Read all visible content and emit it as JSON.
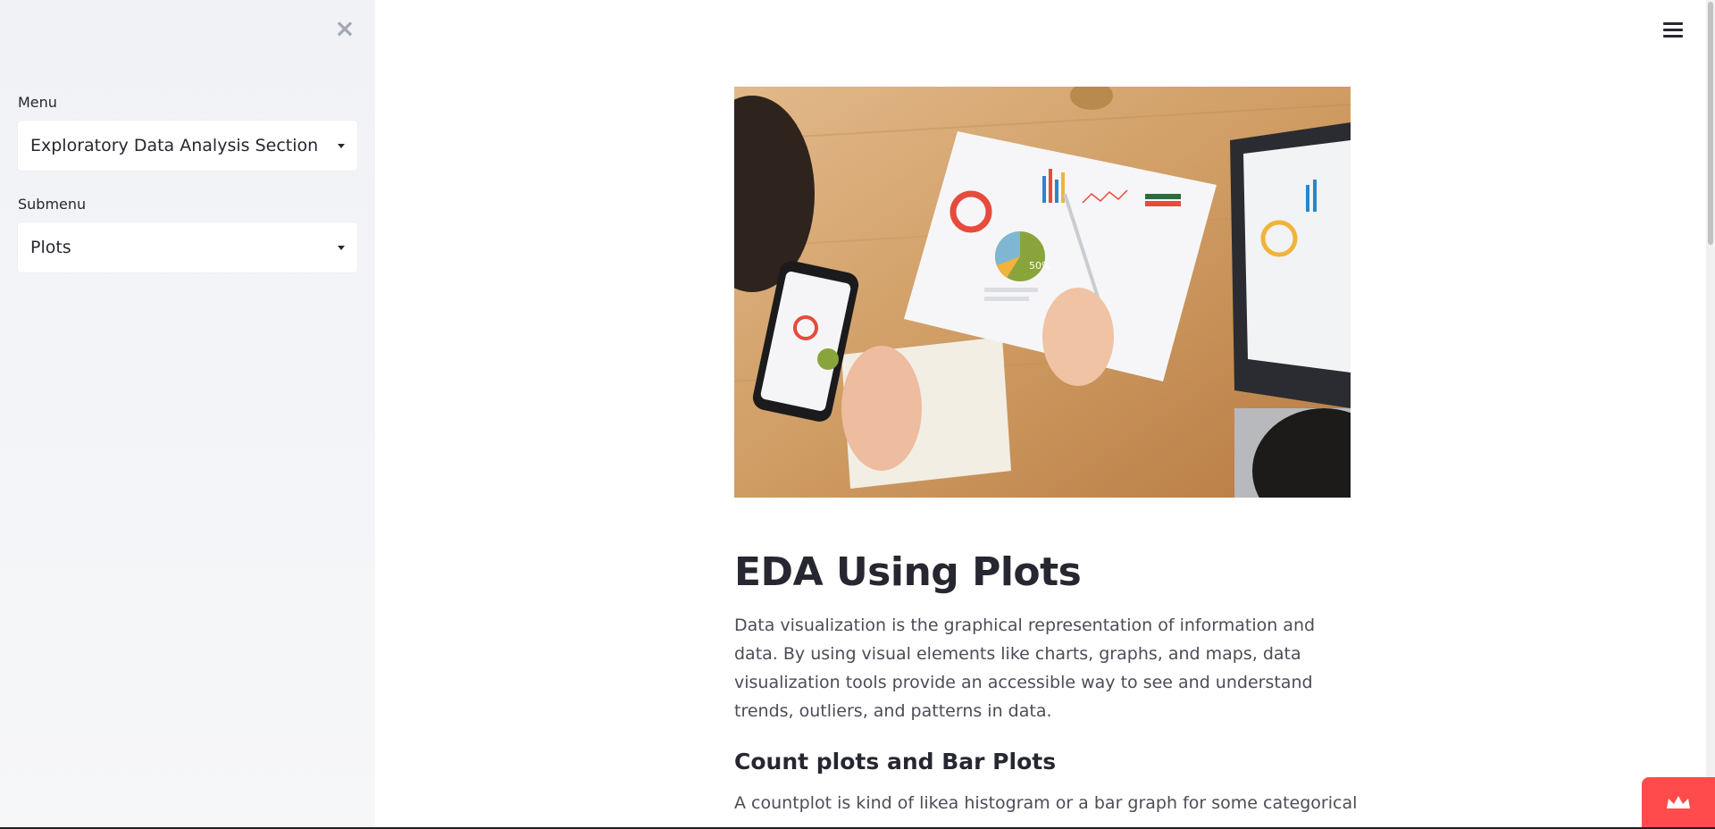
{
  "sidebar": {
    "menu_label": "Menu",
    "menu_selected": "Exploratory Data Analysis Section",
    "submenu_label": "Submenu",
    "submenu_selected": "Plots"
  },
  "main": {
    "title": "EDA Using Plots",
    "intro": "Data visualization is the graphical representation of information and data. By using visual elements like charts, graphs, and maps, data visualization tools provide an accessible way to see and understand trends, outliers, and patterns in data.",
    "section_heading": "Count plots and Bar Plots",
    "section_text": "A countplot is kind of likea histogram or a bar graph for some categorical",
    "hero_text": "50%"
  },
  "colors": {
    "accent": "#ff4b4b",
    "sidebar_bg": "#f0f2f6",
    "text": "#262730"
  },
  "icons": {
    "close": "close-icon",
    "menu": "hamburger-menu-icon",
    "badge": "crown-icon"
  }
}
